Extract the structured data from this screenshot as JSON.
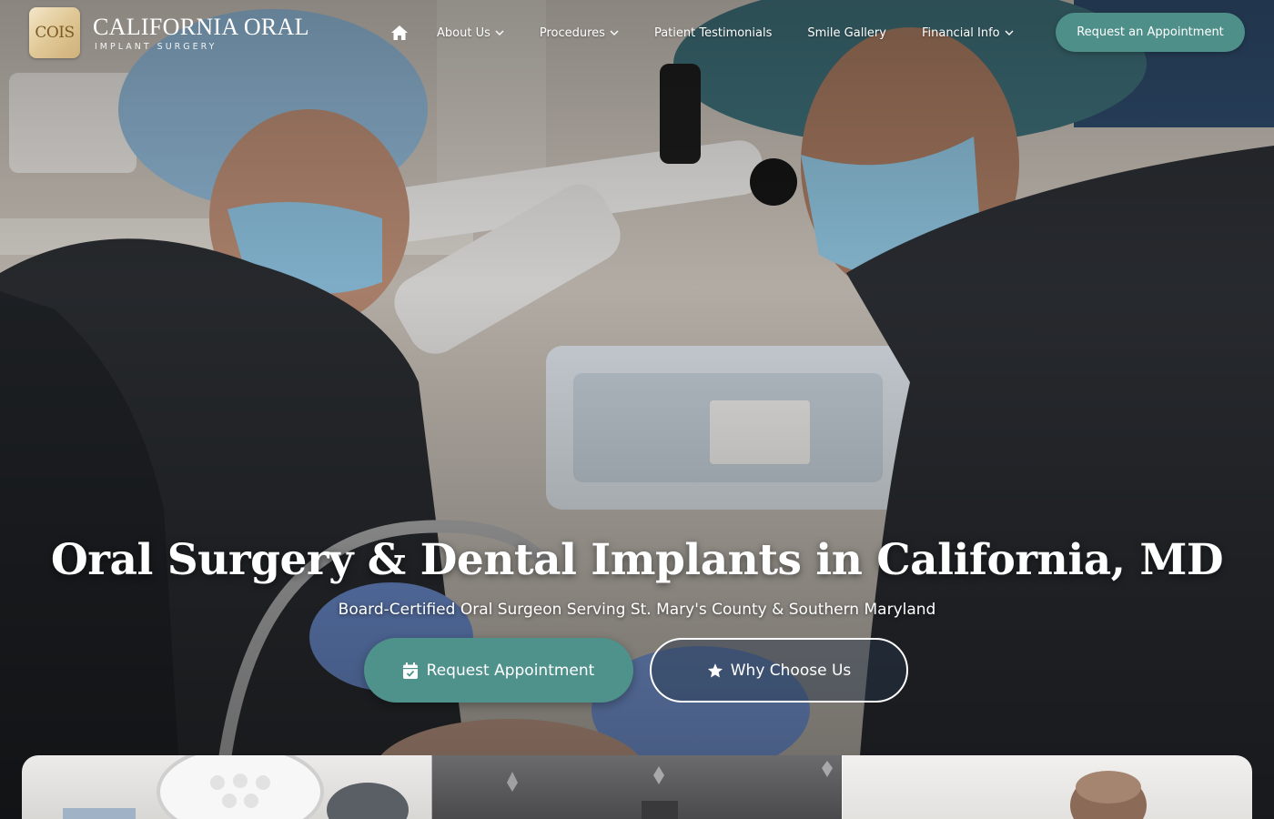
{
  "brand": {
    "mark": "COIS",
    "title": "CALIFORNIA ORAL",
    "subtitle": "IMPLANT SURGERY"
  },
  "nav": {
    "home_icon": "home-icon",
    "items": [
      {
        "label": "About Us",
        "has_dropdown": true
      },
      {
        "label": "Procedures",
        "has_dropdown": true
      },
      {
        "label": "Patient Testimonials",
        "has_dropdown": false
      },
      {
        "label": "Smile Gallery",
        "has_dropdown": false
      },
      {
        "label": "Financial Info",
        "has_dropdown": true
      }
    ],
    "cta_label": "Request an Appointment"
  },
  "hero": {
    "title": "Oral Surgery & Dental Implants in California, MD",
    "subtitle": "Board-Certified Oral Surgeon Serving St. Mary's County & Southern Maryland",
    "primary_button": {
      "label": "Request Appointment",
      "icon": "calendar-check-icon"
    },
    "secondary_button": {
      "label": "Why Choose Us",
      "icon": "star-icon"
    }
  },
  "colors": {
    "accent": "#4f918b",
    "brand_gold": "#e0c896",
    "text_light": "#ffffff"
  }
}
